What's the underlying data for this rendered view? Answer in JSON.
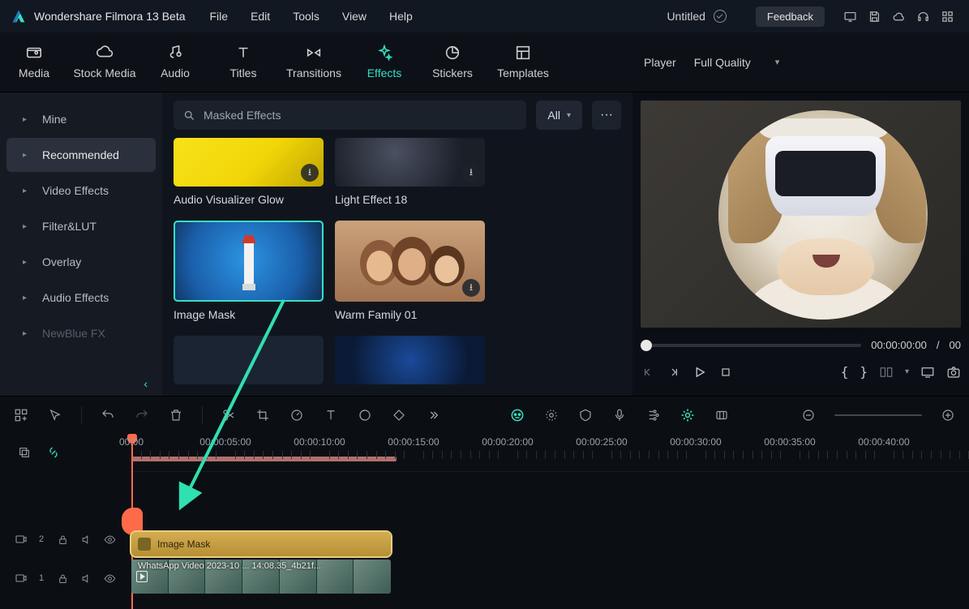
{
  "app": {
    "title": "Wondershare Filmora 13 Beta",
    "doc_title": "Untitled",
    "feedback": "Feedback"
  },
  "menu": [
    "File",
    "Edit",
    "Tools",
    "View",
    "Help"
  ],
  "tabs": [
    {
      "id": "media",
      "label": "Media"
    },
    {
      "id": "stock-media",
      "label": "Stock Media"
    },
    {
      "id": "audio",
      "label": "Audio"
    },
    {
      "id": "titles",
      "label": "Titles"
    },
    {
      "id": "transitions",
      "label": "Transitions"
    },
    {
      "id": "effects",
      "label": "Effects",
      "active": true
    },
    {
      "id": "stickers",
      "label": "Stickers"
    },
    {
      "id": "templates",
      "label": "Templates"
    }
  ],
  "player": {
    "label": "Player",
    "quality": "Full Quality"
  },
  "sidebar": {
    "items": [
      {
        "label": "Mine"
      },
      {
        "label": "Recommended",
        "selected": true
      },
      {
        "label": "Video Effects"
      },
      {
        "label": "Filter&LUT"
      },
      {
        "label": "Overlay"
      },
      {
        "label": "Audio Effects"
      },
      {
        "label": "NewBlue FX",
        "dim": true
      }
    ]
  },
  "search": {
    "placeholder": "Masked Effects",
    "filter_all": "All"
  },
  "fx": [
    {
      "label": "Audio Visualizer Glow",
      "cls": "t-av",
      "dl": true,
      "short": true
    },
    {
      "label": "Light Effect 18",
      "cls": "t-le",
      "dl": true,
      "short": true
    },
    {
      "label": "Image Mask",
      "cls": "t-im",
      "sel": true
    },
    {
      "label": "Warm Family 01",
      "cls": "t-wf",
      "dl": true
    },
    {
      "label": "",
      "cls": "t-b1",
      "short": true
    },
    {
      "label": "",
      "cls": "t-b2",
      "short": true
    }
  ],
  "preview": {
    "time_current": "00:00:00:00",
    "time_sep": "/",
    "time_total": "00"
  },
  "ruler": {
    "ticks": [
      "00:00",
      "00:00:05:00",
      "00:00:10:00",
      "00:00:15:00",
      "00:00:20:00",
      "00:00:25:00",
      "00:00:30:00",
      "00:00:35:00",
      "00:00:40:00"
    ]
  },
  "tracks": {
    "effect_clip": "Image Mask",
    "video_clip": "WhatsApp Video 2023-10 ... 14:08.35_4b21f...",
    "t2": "2",
    "t1": "1"
  }
}
